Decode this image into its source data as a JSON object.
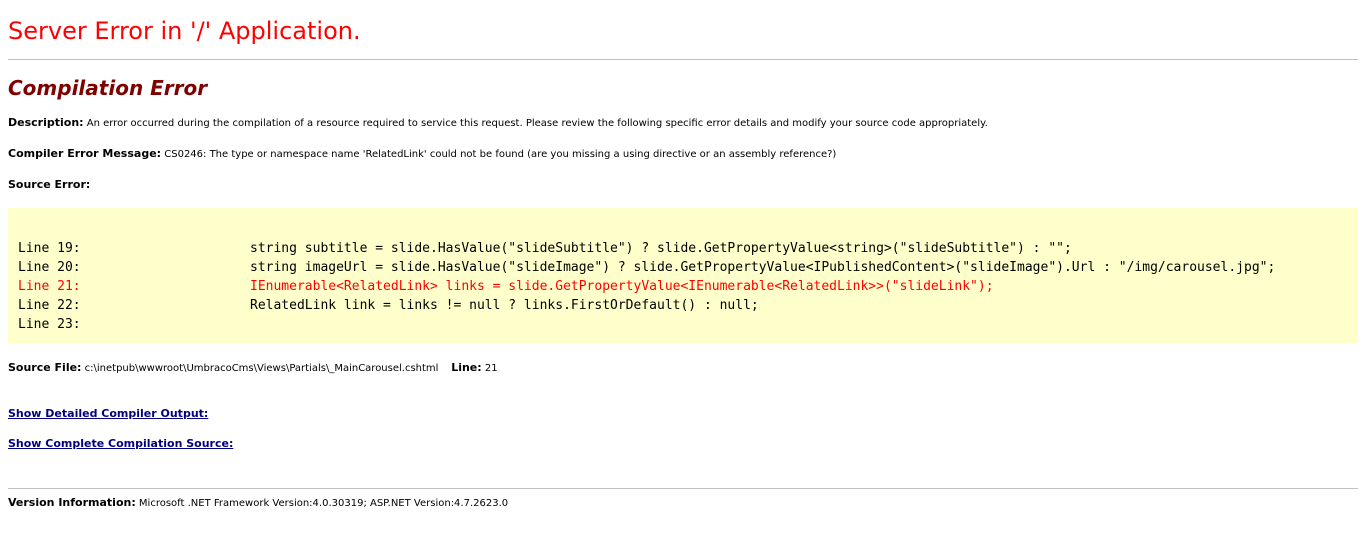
{
  "title": "Server Error in '/' Application.",
  "subtitle": "Compilation Error",
  "description": {
    "label": "Description:",
    "text": "An error occurred during the compilation of a resource required to service this request. Please review the following specific error details and modify your source code appropriately."
  },
  "compiler_error": {
    "label": "Compiler Error Message:",
    "text": "CS0246: The type or namespace name 'RelatedLink' could not be found (are you missing a using directive or an assembly reference?)"
  },
  "source_error": {
    "label": "Source Error:"
  },
  "code_lines": [
    {
      "line": "Line 19:",
      "code": "string subtitle = slide.HasValue(\"slideSubtitle\") ? slide.GetPropertyValue<string>(\"slideSubtitle\") : \"\";",
      "error": false
    },
    {
      "line": "Line 20:",
      "code": "string imageUrl = slide.HasValue(\"slideImage\") ? slide.GetPropertyValue<IPublishedContent>(\"slideImage\").Url : \"/img/carousel.jpg\";",
      "error": false
    },
    {
      "line": "Line 21:",
      "code": "IEnumerable<RelatedLink> links = slide.GetPropertyValue<IEnumerable<RelatedLink>>(\"slideLink\");",
      "error": true
    },
    {
      "line": "Line 22:",
      "code": "RelatedLink link = links != null ? links.FirstOrDefault() : null;",
      "error": false
    },
    {
      "line": "Line 23:",
      "code": "",
      "error": false
    }
  ],
  "source_file": {
    "label": "Source File:",
    "path": "c:\\inetpub\\wwwroot\\UmbracoCms\\Views\\Partials\\_MainCarousel.cshtml",
    "line_label": "Line:",
    "line_value": "21"
  },
  "links": {
    "detailed_output": "Show Detailed Compiler Output:",
    "complete_source": "Show Complete Compilation Source:"
  },
  "version": {
    "label": "Version Information:",
    "text": "Microsoft .NET Framework Version:4.0.30319; ASP.NET Version:4.7.2623.0"
  },
  "colors": {
    "title": "#ff0000",
    "subtitle": "#800000",
    "code_background": "#ffffcc",
    "error_line": "#ff0000",
    "link": "#000080"
  }
}
